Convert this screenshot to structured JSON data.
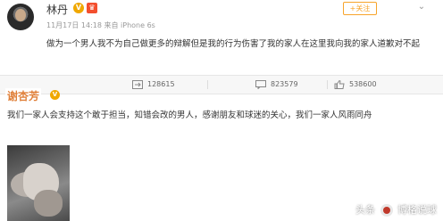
{
  "post1": {
    "username": "林丹",
    "vip_badge": "V",
    "meta": "11月17日 14:18 来自 iPhone 6s",
    "follow_label": "+关注",
    "text": "做为一个男人我不为自己做更多的辩解但是我的行为伤害了我的家人在这里我向我的家人道歉对不起"
  },
  "actions": {
    "reposts": "128615",
    "comments": "823579",
    "likes": "538600"
  },
  "post2": {
    "username": "谢杏芳",
    "vip_badge": "V",
    "text": "我们一家人会支持这个敢于担当，知错会改的男人，感谢朋友和球迷的关心，我们一家人风雨同舟"
  },
  "watermark": {
    "prefix": "头条",
    "account": "博格说球"
  },
  "colors": {
    "accent_orange": "#f7a42a",
    "username2": "#e0803a",
    "badge": "#f0a800"
  }
}
